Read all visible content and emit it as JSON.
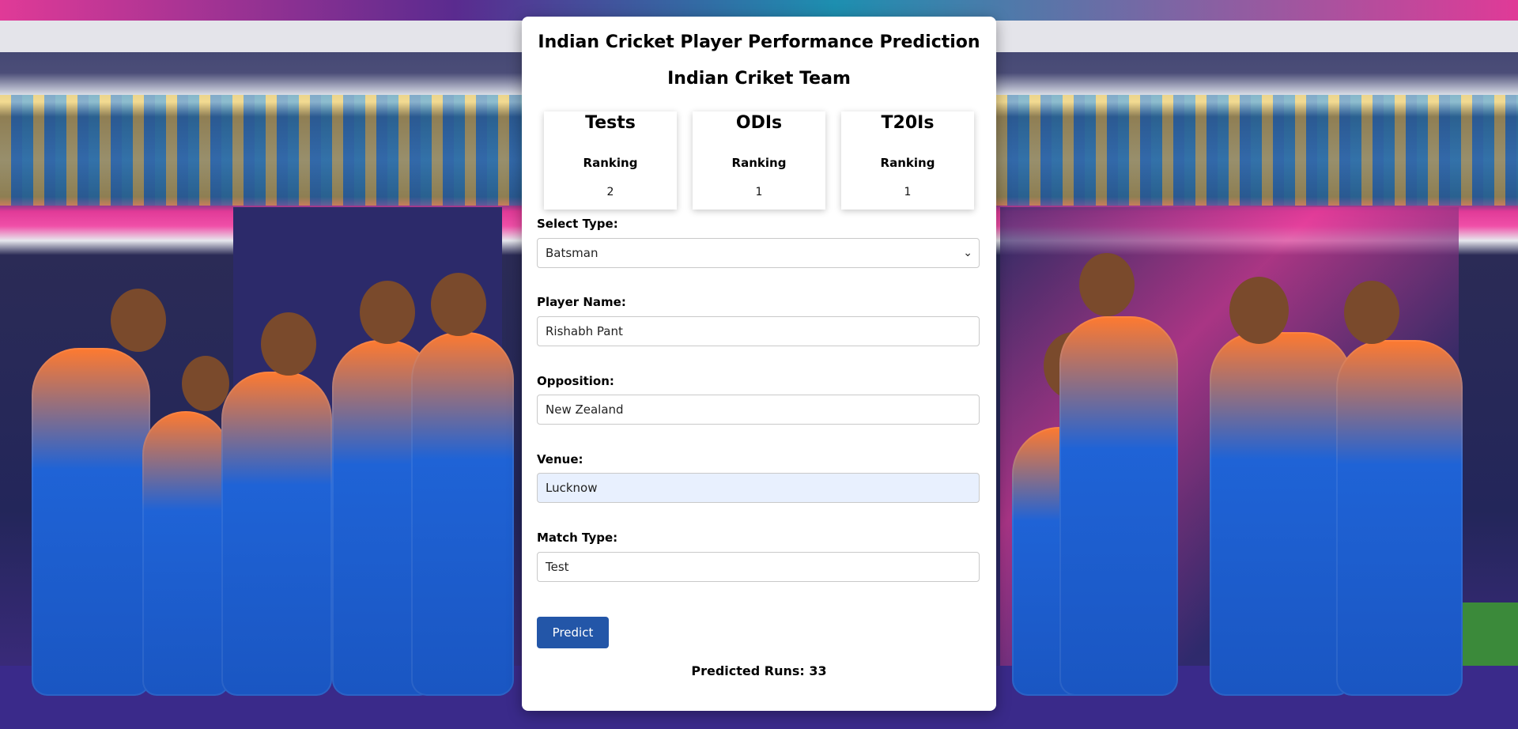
{
  "page": {
    "title": "Indian Cricket Player Performance Prediction",
    "subtitle": "Indian Criket Team"
  },
  "rankings": [
    {
      "format": "Tests",
      "label": "Ranking",
      "value": "2"
    },
    {
      "format": "ODIs",
      "label": "Ranking",
      "value": "1"
    },
    {
      "format": "T20Is",
      "label": "Ranking",
      "value": "1"
    }
  ],
  "form": {
    "type_label": "Select Type:",
    "type_value": "Batsman",
    "player_label": "Player Name:",
    "player_value": "Rishabh Pant",
    "opposition_label": "Opposition:",
    "opposition_value": "New Zealand",
    "venue_label": "Venue:",
    "venue_value": "Lucknow",
    "match_type_label": "Match Type:",
    "match_type_value": "Test",
    "predict_label": "Predict"
  },
  "result": {
    "text": "Predicted Runs: 33"
  },
  "colors": {
    "button": "#2356a8",
    "autofill": "#e8f0fe"
  },
  "icons": {
    "select": "chevron-down-icon"
  }
}
